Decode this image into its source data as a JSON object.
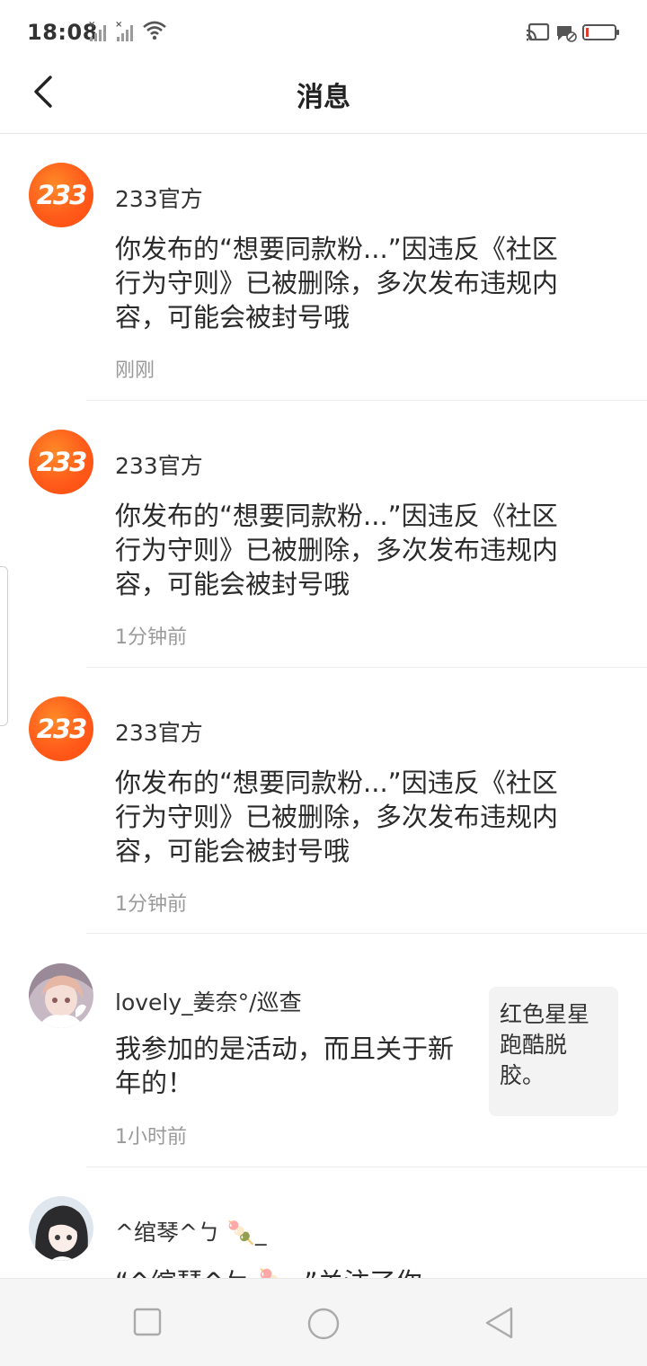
{
  "status_bar": {
    "time": "18:08"
  },
  "header": {
    "title": "消息"
  },
  "messages": [
    {
      "avatar_text": "233",
      "sender": "233官方",
      "content": "你发布的“想要同款粉...”因违反《社区行为守则》已被删除，多次发布违规内容，可能会被封号哦",
      "time": "刚刚"
    },
    {
      "avatar_text": "233",
      "sender": "233官方",
      "content": "你发布的“想要同款粉...”因违反《社区行为守则》已被删除，多次发布违规内容，可能会被封号哦",
      "time": "1分钟前"
    },
    {
      "avatar_text": "233",
      "sender": "233官方",
      "content": "你发布的“想要同款粉...”因违反《社区行为守则》已被删除，多次发布违规内容，可能会被封号哦",
      "time": "1分钟前"
    },
    {
      "sender": "lovely_姜奈°/巡查",
      "content": "我参加的是活动，而且关于新年的！",
      "time": "1小时前",
      "reference": "红色星星跑酷脱胶。"
    },
    {
      "sender": "^绾琴^ㄅ 🍡_",
      "content": "“^绾琴^ㄅ 🍡_”关注了你"
    }
  ],
  "colors": {
    "brand": "#ff5b1a",
    "divider": "#ececec",
    "time_text": "#9a9a9a"
  },
  "icons": {
    "back": "chevron-left-icon",
    "nav_recent": "square-icon",
    "nav_home": "circle-icon",
    "nav_back": "triangle-back-icon"
  }
}
